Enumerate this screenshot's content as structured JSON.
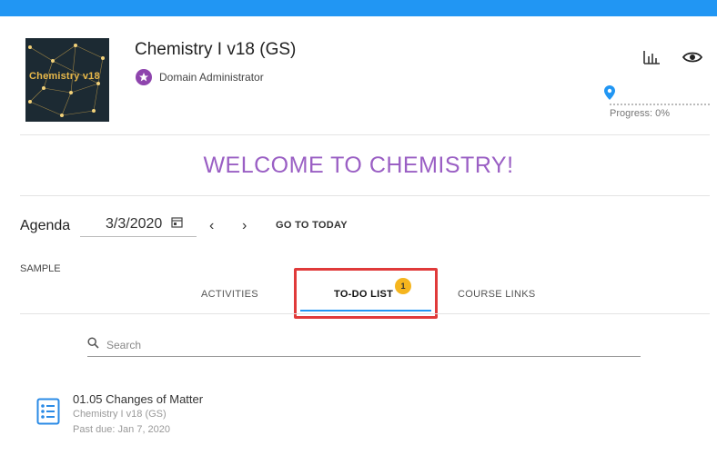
{
  "course": {
    "thumbnail_title": "Chemistry v18",
    "title": "Chemistry I v18 (GS)",
    "role": "Domain Administrator"
  },
  "header_icons": [
    "bar-chart-icon",
    "eye-icon"
  ],
  "progress": {
    "label": "Progress: 0%",
    "value_percent": 0
  },
  "welcome": "WELCOME TO CHEMISTRY!",
  "agenda": {
    "label": "Agenda",
    "date": "3/3/2020",
    "go_today": "GO TO TODAY",
    "prev": "‹",
    "next": "›"
  },
  "section_label": "SAMPLE",
  "tabs": [
    {
      "label": "ACTIVITIES",
      "active": false
    },
    {
      "label": "TO-DO LIST",
      "active": true,
      "badge": "1"
    },
    {
      "label": "COURSE LINKS",
      "active": false
    }
  ],
  "search": {
    "placeholder": "Search",
    "value": ""
  },
  "todos": [
    {
      "title": "01.05 Changes of Matter",
      "course": "Chemistry I v18 (GS)",
      "due": "Past due: Jan 7, 2020"
    }
  ],
  "colors": {
    "accent": "#2196f3",
    "welcome": "#9a5fc4",
    "role_badge": "#8e44ad",
    "tab_badge": "#f5b51e",
    "highlight": "#e03a3a"
  }
}
